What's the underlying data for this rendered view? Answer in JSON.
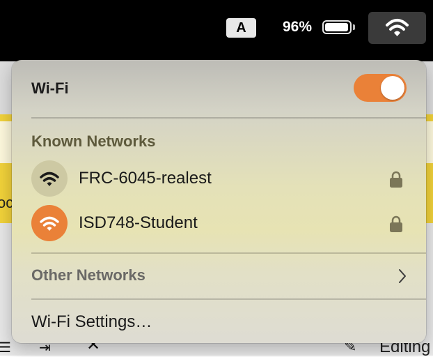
{
  "menubar": {
    "input_source": "A",
    "battery_percent": "96%",
    "battery_level": 0.96
  },
  "background": {
    "cut_text": "oc",
    "editing_label": "Editing"
  },
  "wifi_panel": {
    "title": "Wi-Fi",
    "enabled": true,
    "known_networks_label": "Known Networks",
    "known_networks": [
      {
        "name": "FRC-6045-realest",
        "secured": true,
        "icon": "wifi-icon",
        "icon_bg": "#cdc9a3",
        "icon_fg": "#1a1a1a"
      },
      {
        "name": "ISD748-Student",
        "secured": true,
        "icon": "wifi-icon",
        "icon_bg": "#ea8138",
        "icon_fg": "#ffffff"
      }
    ],
    "other_networks_label": "Other Networks",
    "settings_label": "Wi-Fi Settings…"
  },
  "colors": {
    "accent": "#ea8138",
    "menubar": "#000000"
  }
}
